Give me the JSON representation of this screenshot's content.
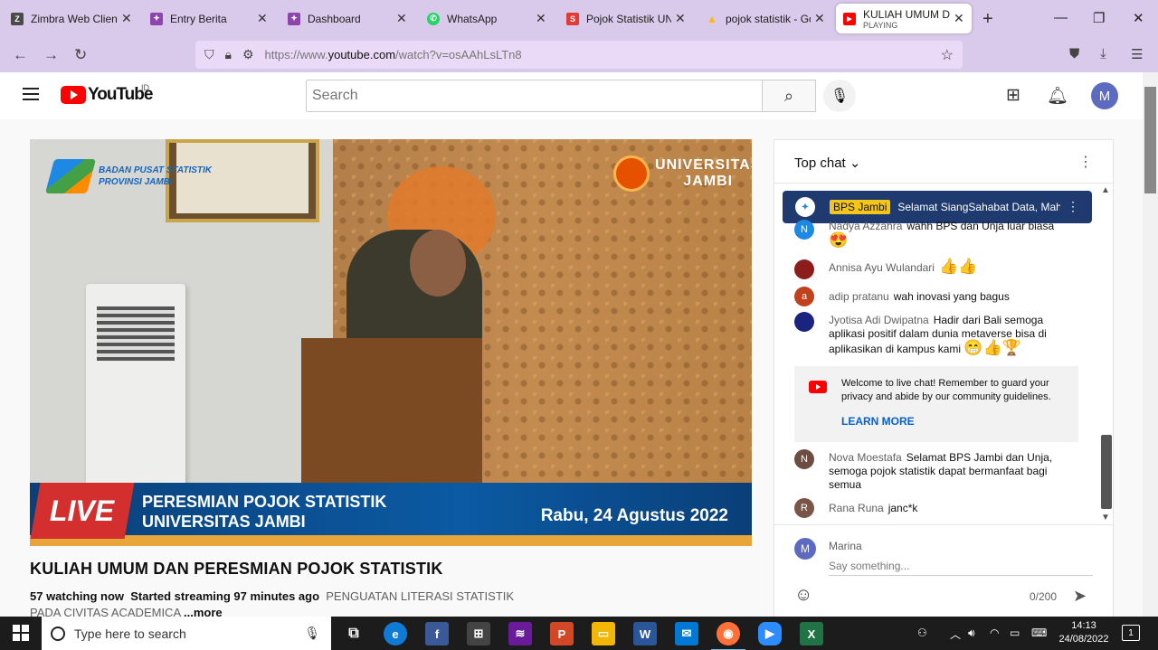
{
  "browser": {
    "tabs": [
      {
        "label": "Zimbra Web Client Sign In",
        "favicon_text": "Z",
        "favicon_color": "#4a4a4a"
      },
      {
        "label": "Entry Berita",
        "favicon_text": "✦",
        "favicon_color": "#8e44ad"
      },
      {
        "label": "Dashboard",
        "favicon_text": "✦",
        "favicon_color": "#8e44ad"
      },
      {
        "label": "WhatsApp",
        "favicon_text": "✆",
        "favicon_color": "#25d366"
      },
      {
        "label": "Pojok Statistik UNJA",
        "favicon_text": "S",
        "favicon_color": "#e53935"
      },
      {
        "label": "pojok statistik - Google Drive",
        "favicon_text": "▲",
        "favicon_color": "#fbbc04"
      },
      {
        "label": "KULIAH UMUM DAN PERESMIAN",
        "favicon_text": "▶",
        "favicon_color": "#ff0000",
        "sub": "PLAYING"
      }
    ],
    "new_tab": "+",
    "window_controls": {
      "minimize": "—",
      "maximize": "❐",
      "close": "✕"
    },
    "url_prefix": "https://www.",
    "url_host": "youtube.com",
    "url_path": "/watch?v=osAAhLsLTn8"
  },
  "youtube": {
    "logo_word": "YouTube",
    "country_code": "ID",
    "search_placeholder": "Search",
    "avatar_letter": "M"
  },
  "video": {
    "bps_line1": "BADAN PUSAT STATISTIK",
    "bps_line2": "PROVINSI JAMBI",
    "unja_line1": "UNIVERSITAS",
    "unja_line2": "JAMBI",
    "live_label": "LIVE",
    "lower_title_1": "PERESMIAN POJOK STATISTIK",
    "lower_title_2": "UNIVERSITAS JAMBI",
    "lower_date": "Rabu, 24 Agustus 2022",
    "title": "KULIAH UMUM DAN PERESMIAN POJOK STATISTIK",
    "watching": "57 watching now",
    "started": "Started streaming 97 minutes ago",
    "description": "PENGUATAN LITERASI STATISTIK PADA CIVITAS ACADEMICA",
    "more": "...more"
  },
  "chat": {
    "header": "Top chat",
    "pinned": {
      "author": "BPS Jambi",
      "message": "Selamat SiangSahabat Data, Mahasiswa",
      "avatar_letter": "✦"
    },
    "messages": [
      {
        "letter": "N",
        "color": "#1e88e5",
        "author": "Nadya Azzahra",
        "text": "wahh BPS dan Unja luar biasa",
        "emoji": "😍"
      },
      {
        "letter": "",
        "color": "#8d1c1c",
        "author": "Annisa Ayu Wulandari",
        "text": "",
        "emoji": "👍👍"
      },
      {
        "letter": "a",
        "color": "#c1411d",
        "author": "adip pratanu",
        "text": "wah inovasi yang bagus",
        "emoji": ""
      },
      {
        "letter": "",
        "color": "#1a237e",
        "author": "Jyotisa Adi Dwipatna",
        "text": "Hadir dari Bali semoga aplikasi positif dalam dunia metaverse bisa di aplikasikan di kampus kami",
        "emoji": "😁👍🏆"
      },
      {
        "letter": "N",
        "color": "#6d4c41",
        "author": "Nova Moestafa",
        "text": "Selamat BPS Jambi dan Unja, semoga pojok statistik dapat bermanfaat bagi semua",
        "emoji": ""
      },
      {
        "letter": "R",
        "color": "#795548",
        "author": "Rana Runa",
        "text": "janc*k",
        "emoji": ""
      }
    ],
    "welcome_text": "Welcome to live chat! Remember to guard your privacy and abide by our community guidelines.",
    "welcome_link": "LEARN MORE",
    "me_name": "Marina",
    "me_letter": "M",
    "input_placeholder": "Say something...",
    "char_count": "0/200"
  },
  "taskbar": {
    "search_placeholder": "Type here to search",
    "time": "14:13",
    "date": "24/08/2022",
    "notifications": "1"
  }
}
